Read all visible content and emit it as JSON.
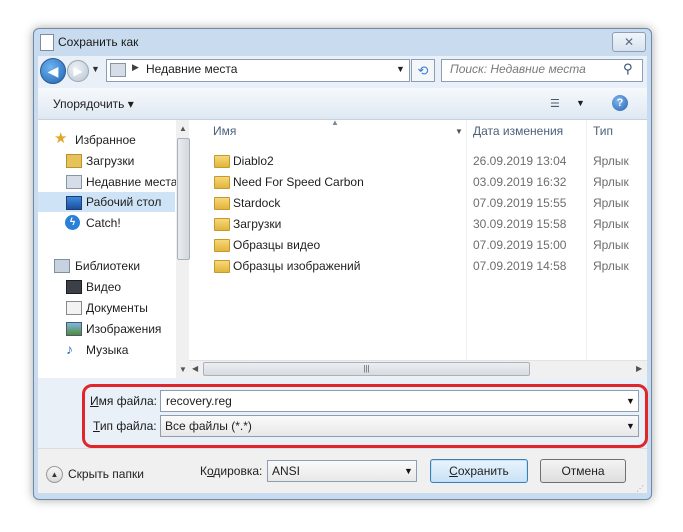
{
  "window": {
    "title": "Сохранить как",
    "close_symbol": "✕"
  },
  "nav": {
    "back_symbol": "◀",
    "forward_symbol": "▶",
    "address": "Недавние места",
    "search_placeholder": "Поиск: Недавние места",
    "refresh_symbol": "⟲"
  },
  "toolbar": {
    "organize_label": "Упорядочить ▾",
    "help_symbol": "?"
  },
  "sidebar": {
    "items": [
      {
        "label": "Избранное"
      },
      {
        "label": "Загрузки"
      },
      {
        "label": "Недавние места"
      },
      {
        "label": "Рабочий стол",
        "selected": true
      },
      {
        "label": "Catch!"
      },
      {
        "label": "Библиотеки"
      },
      {
        "label": "Видео"
      },
      {
        "label": "Документы"
      },
      {
        "label": "Изображения"
      },
      {
        "label": "Музыка"
      }
    ]
  },
  "columns": {
    "name": "Имя",
    "date": "Дата изменения",
    "type": "Тип"
  },
  "files": [
    {
      "name": "Diablo2",
      "date": "26.09.2019 13:04",
      "type": "Ярлык"
    },
    {
      "name": "Need For Speed Carbon",
      "date": "03.09.2019 16:32",
      "type": "Ярлык"
    },
    {
      "name": "Stardock",
      "date": "07.09.2019 15:55",
      "type": "Ярлык"
    },
    {
      "name": "Загрузки",
      "date": "30.09.2019 15:58",
      "type": "Ярлык"
    },
    {
      "name": "Образцы видео",
      "date": "07.09.2019 15:00",
      "type": "Ярлык"
    },
    {
      "name": "Образцы изображений",
      "date": "07.09.2019 14:58",
      "type": "Ярлык"
    }
  ],
  "form": {
    "filename_label_u": "И",
    "filename_label_rest": "мя файла:",
    "filename_value": "recovery.reg",
    "filetype_label_u": "Т",
    "filetype_label_rest": "ип файла:",
    "filetype_value": "Все файлы  (*.*)"
  },
  "footer": {
    "hide_folders": "Скрыть папки",
    "encoding_label_pre": "К",
    "encoding_label_u": "о",
    "encoding_label_rest": "дировка:",
    "encoding_value": "ANSI",
    "save_pre": "",
    "save_u": "С",
    "save_rest": "охранить",
    "cancel": "Отмена"
  },
  "colors": {
    "highlight": "#e0252b",
    "selection": "#cfe3f6",
    "accent": "#1e63b4"
  }
}
